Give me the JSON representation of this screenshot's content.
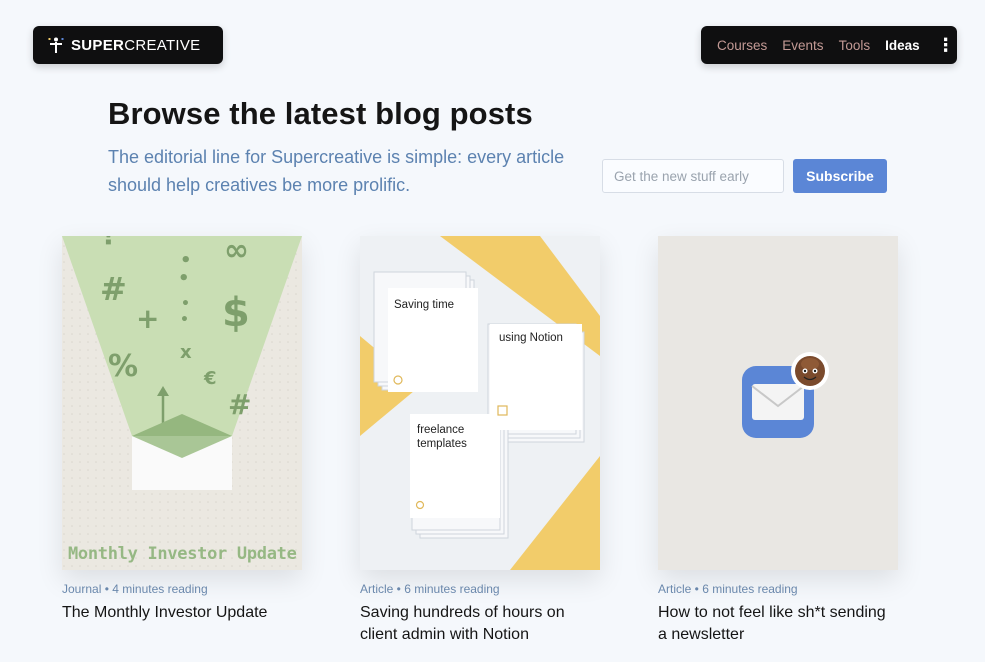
{
  "brand": {
    "bold": "SUPER",
    "light": "CREATIVE"
  },
  "nav": {
    "items": [
      "Courses",
      "Events",
      "Tools",
      "Ideas"
    ],
    "active": "Ideas"
  },
  "hero": {
    "heading": "Browse the latest blog posts",
    "subtitle": "The editorial line for Supercreative is simple: every article should help creatives be more prolific."
  },
  "signup": {
    "placeholder": "Get the new stuff early",
    "button": "Subscribe"
  },
  "posts": [
    {
      "meta": "Journal • 4 minutes reading",
      "title": "The Monthly Investor Update",
      "thumb_label": "Monthly Investor Update"
    },
    {
      "meta": "Article • 6 minutes reading",
      "title": "Saving hundreds of hours on client admin with Notion",
      "notes": [
        "Saving time",
        "using Notion",
        "freelance templates"
      ]
    },
    {
      "meta": "Article • 6 minutes reading",
      "title": "How to not feel like sh*t sending a newsletter"
    }
  ],
  "colors": {
    "accent": "#5b86d6",
    "nav_inactive": "#c39a95",
    "meta": "#6d8bb0",
    "green": "#96b884",
    "yellow": "#f2cc6a"
  },
  "icons": [
    "brand-mark-icon",
    "more-vertical-icon",
    "mail-icon",
    "poop-emoji-icon"
  ]
}
